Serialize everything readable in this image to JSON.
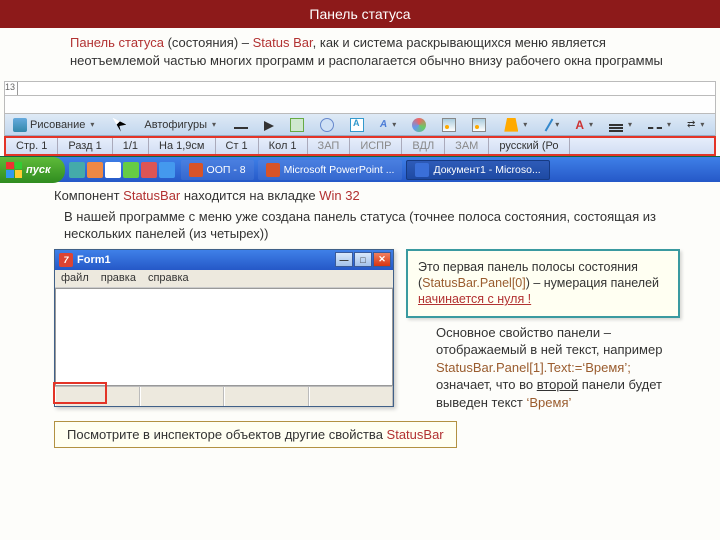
{
  "header": {
    "title": "Панель статуса"
  },
  "intro": {
    "t1": "Панель статуса",
    "mid1": " (состояния) – ",
    "t2": "Status Bar",
    "rest": ", как и система раскрывающихся меню является неотъемлемой частью многих программ и располагается обычно внизу рабочего окна программы"
  },
  "word_ui": {
    "ruler_num": "13",
    "draw_label": "Рисование",
    "autoshapes": "Автофигуры",
    "status": {
      "page": "Стр. 1",
      "section": "Разд 1",
      "pages": "1/1",
      "at": "На 1,9см",
      "line": "Ст 1",
      "col": "Кол 1",
      "rec": "ЗАП",
      "trk": "ИСПР",
      "ext": "ВДЛ",
      "ovr": "ЗАМ",
      "lang": "русский (Ро"
    }
  },
  "taskbar": {
    "start": "пуск",
    "items": [
      {
        "label": "ООП - 8"
      },
      {
        "label": "Microsoft PowerPoint ..."
      },
      {
        "label": "Документ1 - Microso..."
      }
    ]
  },
  "comp_line": {
    "p1": "Компонент ",
    "sb": "StatusBar",
    "p2": " находится на вкладке ",
    "win": "Win 32"
  },
  "para2": "В нашей программе с меню уже создана панель статуса (точнее полоса состояния, состоящая из нескольких панелей (из четырех))",
  "form1": {
    "title": "Form1",
    "menu": [
      "файл",
      "правка",
      "справка"
    ]
  },
  "callout": {
    "pre": " Это первая панель полосы состояния (",
    "code": "StatusBar.Panel[0]",
    "mid": ") – нумерация панелей ",
    "tail": "начинается с нуля !"
  },
  "right": {
    "a": " Основное свойство панели – отображаемый в ней текст, например ",
    "code": "StatusBar.Panel[1].Text:=‘Время’;",
    "b1": " означает, что во ",
    "u": "второй",
    "b2": " панели будет выведен текст ",
    "v": "‘Время’"
  },
  "inspect": {
    "t1": "Посмотрите в инспекторе объектов  другие свойства ",
    "sb": "StatusBar"
  }
}
